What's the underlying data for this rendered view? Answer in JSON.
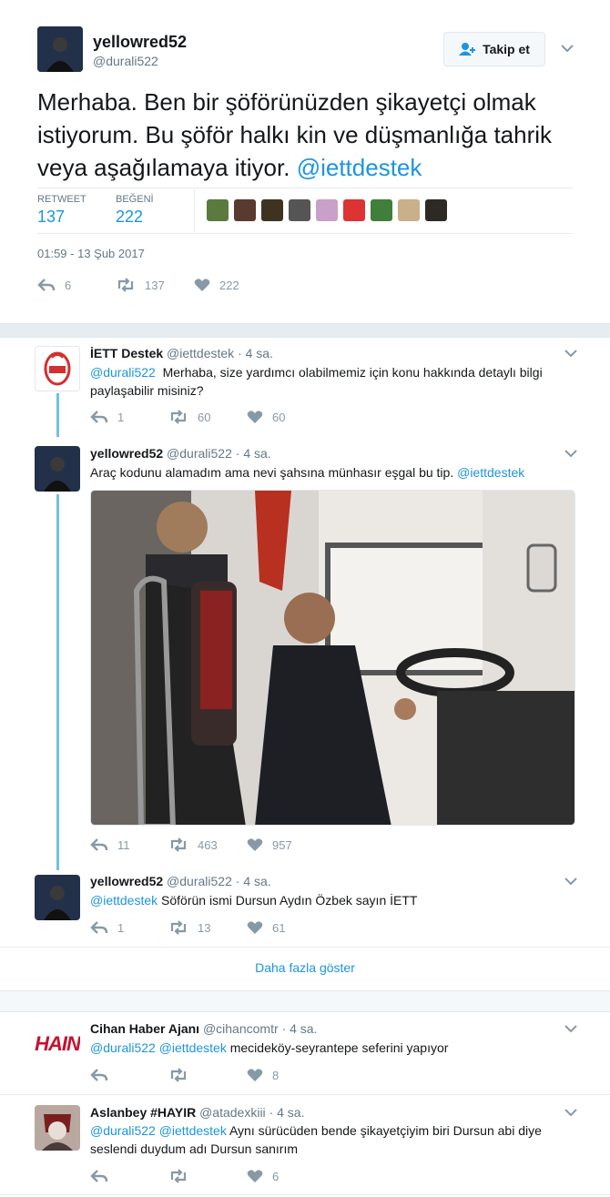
{
  "main_tweet": {
    "name": "yellowred52",
    "handle": "@durali522",
    "follow_label": "Takip et",
    "text": "Merhaba. Ben bir şöförünüzden şikayetçi olmak istiyorum. Bu şöför halkı kin ve düşmanlığa tahrik veya aşağılamaya itiyor.",
    "mention": "@iettdestek",
    "retweet_label": "RETWEET",
    "retweet_count": "137",
    "like_label": "BEĞENİ",
    "like_count": "222",
    "timestamp": "01:59 - 13 Şub 2017",
    "actions": {
      "reply": "6",
      "retweet": "137",
      "like": "222"
    }
  },
  "thread": [
    {
      "name": "İETT Destek",
      "handle": "@iettdestek",
      "time": "4 sa.",
      "mention": "@durali522",
      "text": "Merhaba, size yardımcı olabilmemiz için konu hakkında detaylı bilgi paylaşabilir misiniz?",
      "actions": {
        "reply": "1",
        "retweet": "60",
        "like": "60"
      }
    },
    {
      "name": "yellowred52",
      "handle": "@durali522",
      "time": "4 sa.",
      "text": "Araç kodunu alamadım ama nevi şahsına münhasır eşgal bu tip.",
      "mention": "@iettdestek",
      "actions": {
        "reply": "11",
        "retweet": "463",
        "like": "957"
      }
    },
    {
      "name": "yellowred52",
      "handle": "@durali522",
      "time": "4 sa.",
      "mention": "@iettdestek",
      "text": "Söförün ismi Dursun Aydın Özbek sayın İETT",
      "actions": {
        "reply": "1",
        "retweet": "13",
        "like": "61"
      }
    }
  ],
  "show_more_label": "Daha fazla göster",
  "replies": [
    {
      "name": "Cihan Haber Ajanı",
      "handle": "@cihancomtr",
      "time": "4 sa.",
      "mentions": "@durali522 @iettdestek",
      "text": "mecideköy-seyrantepe seferini yapıyor",
      "logo_text": "HAIN",
      "actions": {
        "reply": "",
        "retweet": "",
        "like": "8"
      }
    },
    {
      "name": "Aslanbey #HAYIR",
      "handle": "@atadexkiii",
      "time": "4 sa.",
      "mentions": "@durali522 @iettdestek",
      "text": "Aynı sürücüden bende şikayetçiyim biri Dursun abi diye seslendi duydum adı Dursun sanırım",
      "actions": {
        "reply": "",
        "retweet": "",
        "like": "6"
      }
    }
  ],
  "colors": {
    "link": "#1b95e0",
    "muted": "#657786",
    "thread_line": "#73c1d9"
  }
}
